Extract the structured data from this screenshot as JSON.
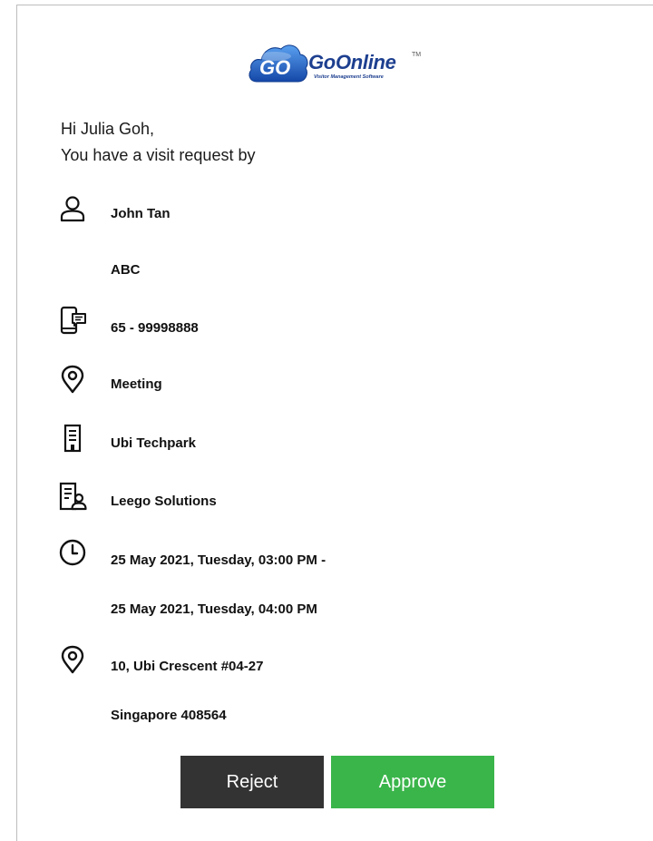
{
  "logo": {
    "badge": "GO",
    "wordmark": "GoOnline",
    "trademark": "TM",
    "tagline": "Visitor Management Software",
    "colors": {
      "cloud_blue": "#1f5fbf",
      "text_blue": "#1d3f8f"
    }
  },
  "greeting": {
    "line1": "Hi Julia Goh,",
    "line2": "You have a visit request by"
  },
  "details": {
    "visitor_name": "John Tan",
    "company": "ABC",
    "phone": "65 - 99998888",
    "purpose": "Meeting",
    "building": "Ubi Techpark",
    "host_company": "Leego Solutions",
    "time_start": "25 May 2021, Tuesday, 03:00 PM -",
    "time_end": "25 May 2021, Tuesday, 04:00 PM",
    "address_line1": "10, Ubi Crescent #04-27",
    "address_line2": "Singapore 408564"
  },
  "icons": {
    "visitor": "person-icon",
    "phone": "mobile-message-icon",
    "purpose": "location-pin-icon",
    "building": "building-icon",
    "host_company": "office-person-icon",
    "time": "clock-icon",
    "address": "location-pin-icon"
  },
  "actions": {
    "reject_label": "Reject",
    "approve_label": "Approve",
    "colors": {
      "reject": "#333333",
      "approve": "#3ab54a"
    }
  }
}
